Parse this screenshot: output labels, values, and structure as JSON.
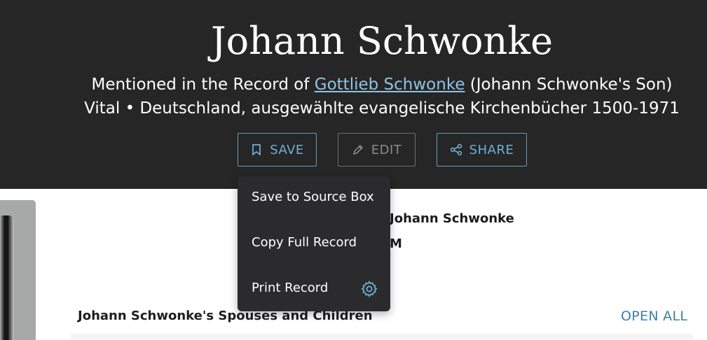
{
  "header": {
    "title": "Johann Schwonke",
    "mentioned_prefix": "Mentioned in the Record of ",
    "mentioned_link": "Gottlieb Schwonke",
    "mentioned_suffix": " (Johann Schwonke's Son)",
    "collection": "Vital • Deutschland, ausgewählte evangelische Kirchenbücher 1500-1971"
  },
  "actions": {
    "save_label": "SAVE",
    "edit_label": "EDIT",
    "share_label": "SHARE"
  },
  "save_menu": {
    "items": [
      "Save to Source Box",
      "Copy Full Record",
      "Print Record"
    ]
  },
  "details": {
    "name_value": "Johann Schwonke",
    "gender_value": "M"
  },
  "family": {
    "section_title": "Johann Schwonke's Spouses and Children",
    "open_all_label": "OPEN ALL"
  },
  "colors": {
    "header_bg": "#262626",
    "accent": "#6fb0d4",
    "link": "#8fc3e2",
    "menu_bg": "#2b2b2d"
  },
  "icons": {
    "save": "bookmark-icon",
    "edit": "pencil-icon",
    "share": "share-icon",
    "settings": "gear-icon"
  }
}
